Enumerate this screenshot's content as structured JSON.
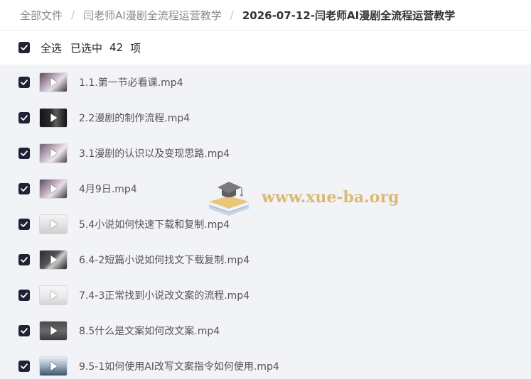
{
  "breadcrumb": {
    "root": "全部文件",
    "parent": "闫老师AI漫剧全流程运营教学",
    "current": "2026-07-12-闫老师AI漫剧全流程运营教学"
  },
  "selection": {
    "select_all_label": "全选",
    "selected_label": "已选中",
    "count": "42",
    "unit": "项"
  },
  "colors": {
    "checkbox": "#1d2334",
    "list_background": "#f2f3f7",
    "watermark": "#d8b36a"
  },
  "files": [
    {
      "name": "1.1.第一节必看课.mp4",
      "icon": "video-thumbnail"
    },
    {
      "name": "2.2漫剧的制作流程.mp4",
      "icon": "video-thumbnail"
    },
    {
      "name": "3.1漫剧的认识以及变现思路.mp4",
      "icon": "video-thumbnail"
    },
    {
      "name": "4月9日.mp4",
      "icon": "video-thumbnail"
    },
    {
      "name": "5.4小说如何快速下载和复制.mp4",
      "icon": "video-thumbnail"
    },
    {
      "name": "6.4-2短篇小说如何找文下载复制.mp4",
      "icon": "video-thumbnail"
    },
    {
      "name": "7.4-3正常找到小说改文案的流程.mp4",
      "icon": "video-thumbnail"
    },
    {
      "name": "8.5什么是文案如何改文案.mp4",
      "icon": "video-thumbnail"
    },
    {
      "name": "9.5-1如何使用AI改写文案指令如何使用.mp4",
      "icon": "video-thumbnail"
    }
  ],
  "watermark": {
    "text": "www.xue-ba.org",
    "icon": "graduation-cap-book-icon"
  }
}
